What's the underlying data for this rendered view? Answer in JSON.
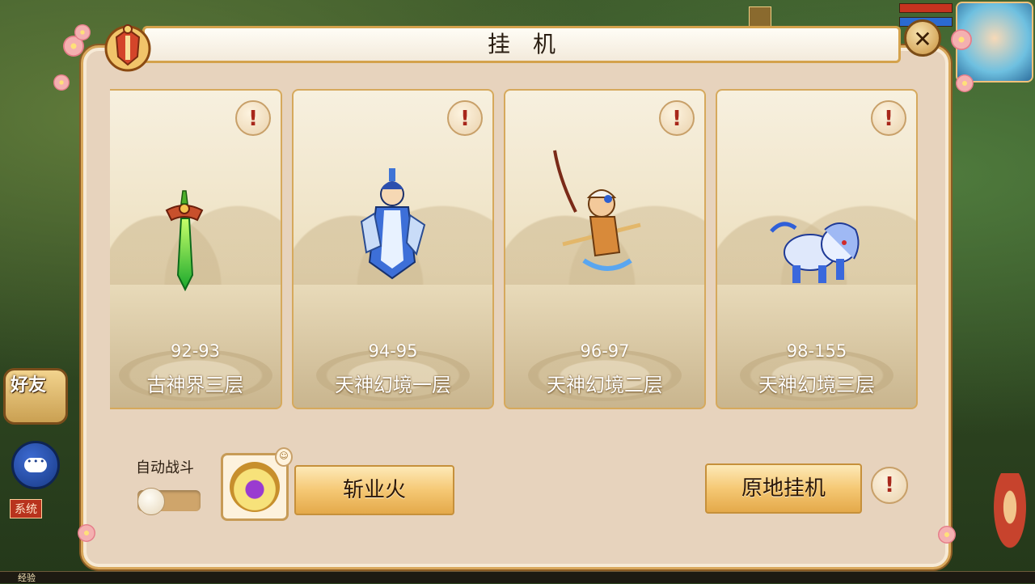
{
  "hud": {
    "friends_label": "好友",
    "system_tag": "系统",
    "exp_label": "经验"
  },
  "dialog": {
    "title": "挂机",
    "close_symbol": "✕"
  },
  "cards": [
    {
      "range": "92-93",
      "place": "古神界三层",
      "info": "!",
      "figure": "jade-sword"
    },
    {
      "range": "94-95",
      "place": "天神幻境一层",
      "info": "!",
      "figure": "blue-warrior"
    },
    {
      "range": "96-97",
      "place": "天神幻境二层",
      "info": "!",
      "figure": "monkey-king"
    },
    {
      "range": "98-155",
      "place": "天神幻境三层",
      "info": "!",
      "figure": "ice-lion"
    }
  ],
  "controls": {
    "auto_battle_label": "自动战斗",
    "auto_battle_on": false,
    "skill_button_label": "斩业火",
    "idle_button_label": "原地挂机",
    "info_symbol": "!"
  },
  "colors": {
    "accent_gold": "#d6a95c",
    "warning_red": "#a8271b",
    "panel_bg": "#e7d3bd"
  }
}
